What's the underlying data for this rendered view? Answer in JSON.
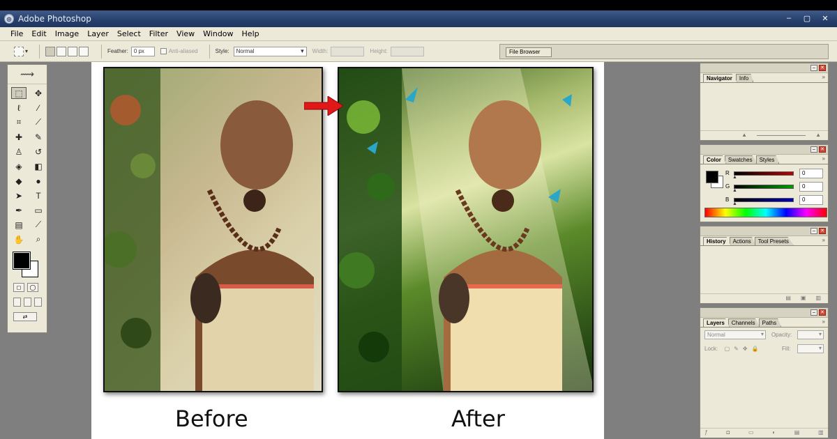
{
  "window": {
    "title": "Adobe Photoshop",
    "controls": [
      "‒",
      "▢",
      "✕"
    ]
  },
  "menu": [
    "File",
    "Edit",
    "Image",
    "Layer",
    "Select",
    "Filter",
    "View",
    "Window",
    "Help"
  ],
  "options": {
    "feather_label": "Feather:",
    "feather_value": "0 px",
    "anti_aliased_label": "Anti-aliased",
    "style_label": "Style:",
    "style_value": "Normal",
    "width_label": "Width:",
    "height_label": "Height:",
    "file_browser_tab": "File Browser"
  },
  "canvas": {
    "before_caption": "Before",
    "after_caption": "After"
  },
  "panels": {
    "navigator": {
      "tabs": [
        "Navigator",
        "Info"
      ]
    },
    "color": {
      "tabs": [
        "Color",
        "Swatches",
        "Styles"
      ],
      "channels": [
        {
          "label": "R",
          "value": "0",
          "color": "#c00000"
        },
        {
          "label": "G",
          "value": "0",
          "color": "#00a000"
        },
        {
          "label": "B",
          "value": "0",
          "color": "#0000c0"
        }
      ]
    },
    "history": {
      "tabs": [
        "History",
        "Actions",
        "Tool Presets"
      ]
    },
    "layers": {
      "tabs": [
        "Layers",
        "Channels",
        "Paths"
      ],
      "blend_mode": "Normal",
      "opacity_label": "Opacity:",
      "lock_label": "Lock:",
      "fill_label": "Fill:"
    }
  },
  "colors": {
    "title_bar": "#27406b",
    "chrome": "#ece9d8",
    "workspace": "#7f7f7f",
    "arrow": "#e01818"
  }
}
